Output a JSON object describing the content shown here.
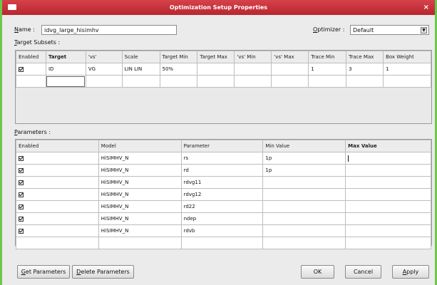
{
  "window": {
    "title": "Optimization Setup Properties",
    "close_glyph": "×"
  },
  "name": {
    "label_u": "N",
    "label_rest": "ame :",
    "value": "idvg_large_hisimhv"
  },
  "optimizer": {
    "label_u": "O",
    "label_rest": "ptimizer :",
    "value": "Default"
  },
  "target_subsets": {
    "label_u": "T",
    "label_rest": "arget Subsets :",
    "columns": [
      "Enabled",
      "Target",
      "'vs'",
      "Scale",
      "Target Min",
      "Target Max",
      "'vs' Min",
      "'vs' Max",
      "Trace Min",
      "Trace Max",
      "Box Weight"
    ],
    "rows": [
      {
        "enabled": true,
        "target": "ID",
        "vs": "VG",
        "scale": "LIN LIN",
        "target_min": "50%",
        "target_max": "",
        "vs_min": "",
        "vs_max": "",
        "trace_min": "1",
        "trace_max": "3",
        "box_weight": "1"
      }
    ]
  },
  "parameters": {
    "label_u": "P",
    "label_rest": "arameters :",
    "columns": [
      "Enabled",
      "Model",
      "Parameter",
      "Min Value",
      "Max Value"
    ],
    "rows": [
      {
        "enabled": true,
        "model": "HiSIMHV_N",
        "parameter": "rs",
        "min": "1p",
        "max": ""
      },
      {
        "enabled": true,
        "model": "HiSIMHV_N",
        "parameter": "rd",
        "min": "1p",
        "max": ""
      },
      {
        "enabled": true,
        "model": "HiSIMHV_N",
        "parameter": "rdvg11",
        "min": "",
        "max": ""
      },
      {
        "enabled": true,
        "model": "HiSIMHV_N",
        "parameter": "rdvg12",
        "min": "",
        "max": ""
      },
      {
        "enabled": true,
        "model": "HiSIMHV_N",
        "parameter": "rd22",
        "min": "",
        "max": ""
      },
      {
        "enabled": true,
        "model": "HiSIMHV_N",
        "parameter": "ndep",
        "min": "",
        "max": ""
      },
      {
        "enabled": true,
        "model": "HiSIMHV_N",
        "parameter": "rdvb",
        "min": "",
        "max": ""
      }
    ]
  },
  "buttons": {
    "get_u": "G",
    "get_rest": "et Parameters",
    "delete_u": "D",
    "delete_rest": "elete Parameters",
    "ok": "OK",
    "cancel": "Cancel",
    "apply_u": "A",
    "apply_rest": "pply"
  }
}
